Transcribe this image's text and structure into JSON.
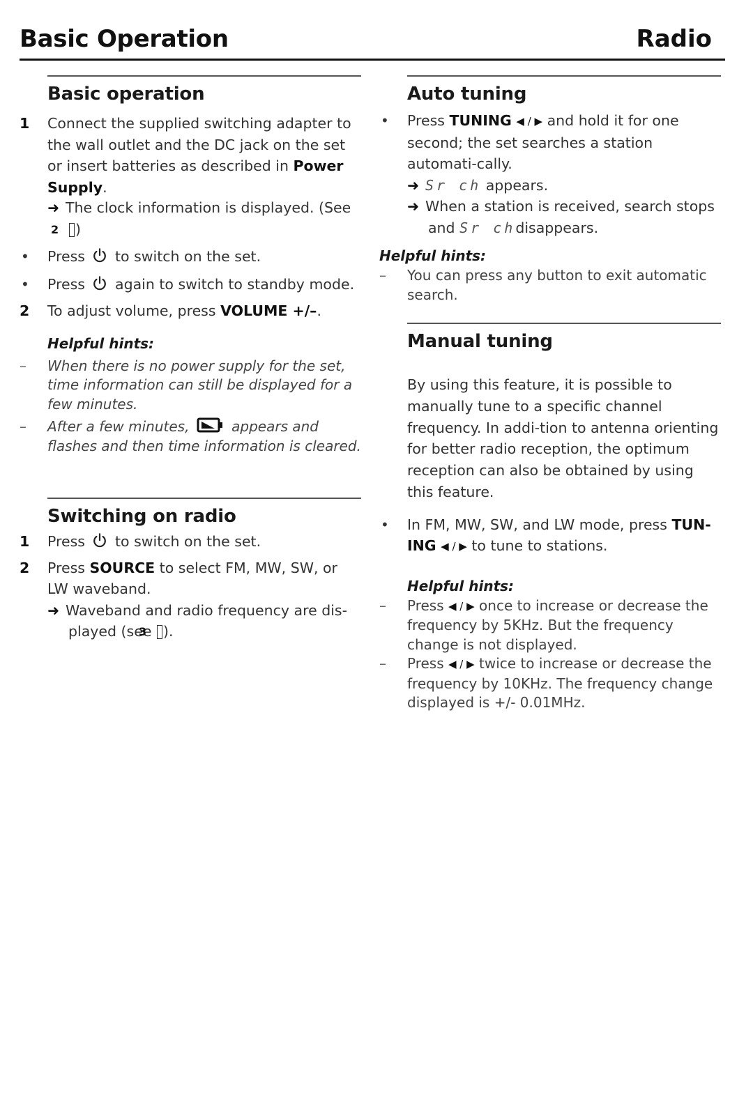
{
  "header": {
    "left_title": "Basic Operation",
    "right_title": "Radio"
  },
  "basic_operation": {
    "title": "Basic operation",
    "step1": {
      "number": "1",
      "text_a": "Connect the supplied switching adapter to the wall outlet and the DC jack on the set or insert batteries as described in ",
      "bold": "Power Supply",
      "text_b": ".",
      "result_a": "The clock information is displayed. (See ",
      "result_ref": "2",
      "result_b": ")"
    },
    "bullet1": {
      "a": "Press ",
      "icon": "power-icon",
      "b": " to switch on the set."
    },
    "bullet2": {
      "a": "Press ",
      "icon": "power-icon",
      "b": " again to switch to standby mode."
    },
    "step2": {
      "number": "2",
      "a": "To adjust volume,  press ",
      "bold": "VOLUME +/–",
      "b": "."
    },
    "hints": {
      "title": "Helpful hints:",
      "items": [
        {
          "dash": "–",
          "text": "When there is no power supply for the set, time information can still be displayed for a few minutes."
        },
        {
          "dash": "–",
          "a": "After a few minutes, ",
          "icon": "battery-icon",
          "b": " appears and flashes and then time information is cleared."
        }
      ]
    }
  },
  "switching_on_radio": {
    "title": "Switching on radio",
    "step1": {
      "number": "1",
      "a": "Press ",
      "icon": "power-icon",
      "b": " to switch on the set."
    },
    "step2": {
      "number": "2",
      "a": "Press ",
      "bold": "SOURCE",
      "b": " to select FM, MW, SW, or LW waveband.",
      "result_a": "Waveband and radio frequency are dis-played (see ",
      "result_ref": "3",
      "result_b": ")."
    }
  },
  "auto_tuning": {
    "title": "Auto tuning",
    "bullet": {
      "a": "Press ",
      "bold": "TUNING",
      "controls": "◀ / ▶",
      "b": " and hold it for one second; the set searches a station automati-cally.",
      "result1_lcd": "Sr ch",
      "result1_b": " appears.",
      "result2_a": "When a station is received,  search stops and ",
      "result2_lcd": "Sr ch",
      "result2_b": "disappears."
    },
    "hints": {
      "title": "Helpful hints:",
      "items": [
        {
          "dash": "–",
          "text": "You can press any button to exit automatic search."
        }
      ]
    }
  },
  "manual_tuning": {
    "title": "Manual tuning",
    "intro": "By using this feature, it is possible to manually tune to a specific channel frequency. In addi-tion to antenna orienting for better radio reception, the optimum reception can also be obtained by using this feature.",
    "bullet": {
      "a": "In FM, MW, SW, and LW mode, press ",
      "bold": "TUN-ING",
      "controls": "◀ / ▶",
      "b": " to tune to stations."
    },
    "hints": {
      "title": "Helpful hints:",
      "items": [
        {
          "dash": "–",
          "a": "Press ",
          "controls": "◀ / ▶",
          "b": " once  to increase or decrease the frequency by 5KHz. But the frequency change is not displayed."
        },
        {
          "dash": "–",
          "a": "Press ",
          "controls": "◀ / ▶",
          "b": " twice to increase or decrease the frequency by 10KHz.  The frequency change displayed is +/- 0.01MHz."
        }
      ]
    }
  },
  "symbols": {
    "arrow": "➜",
    "bullet": "•"
  }
}
